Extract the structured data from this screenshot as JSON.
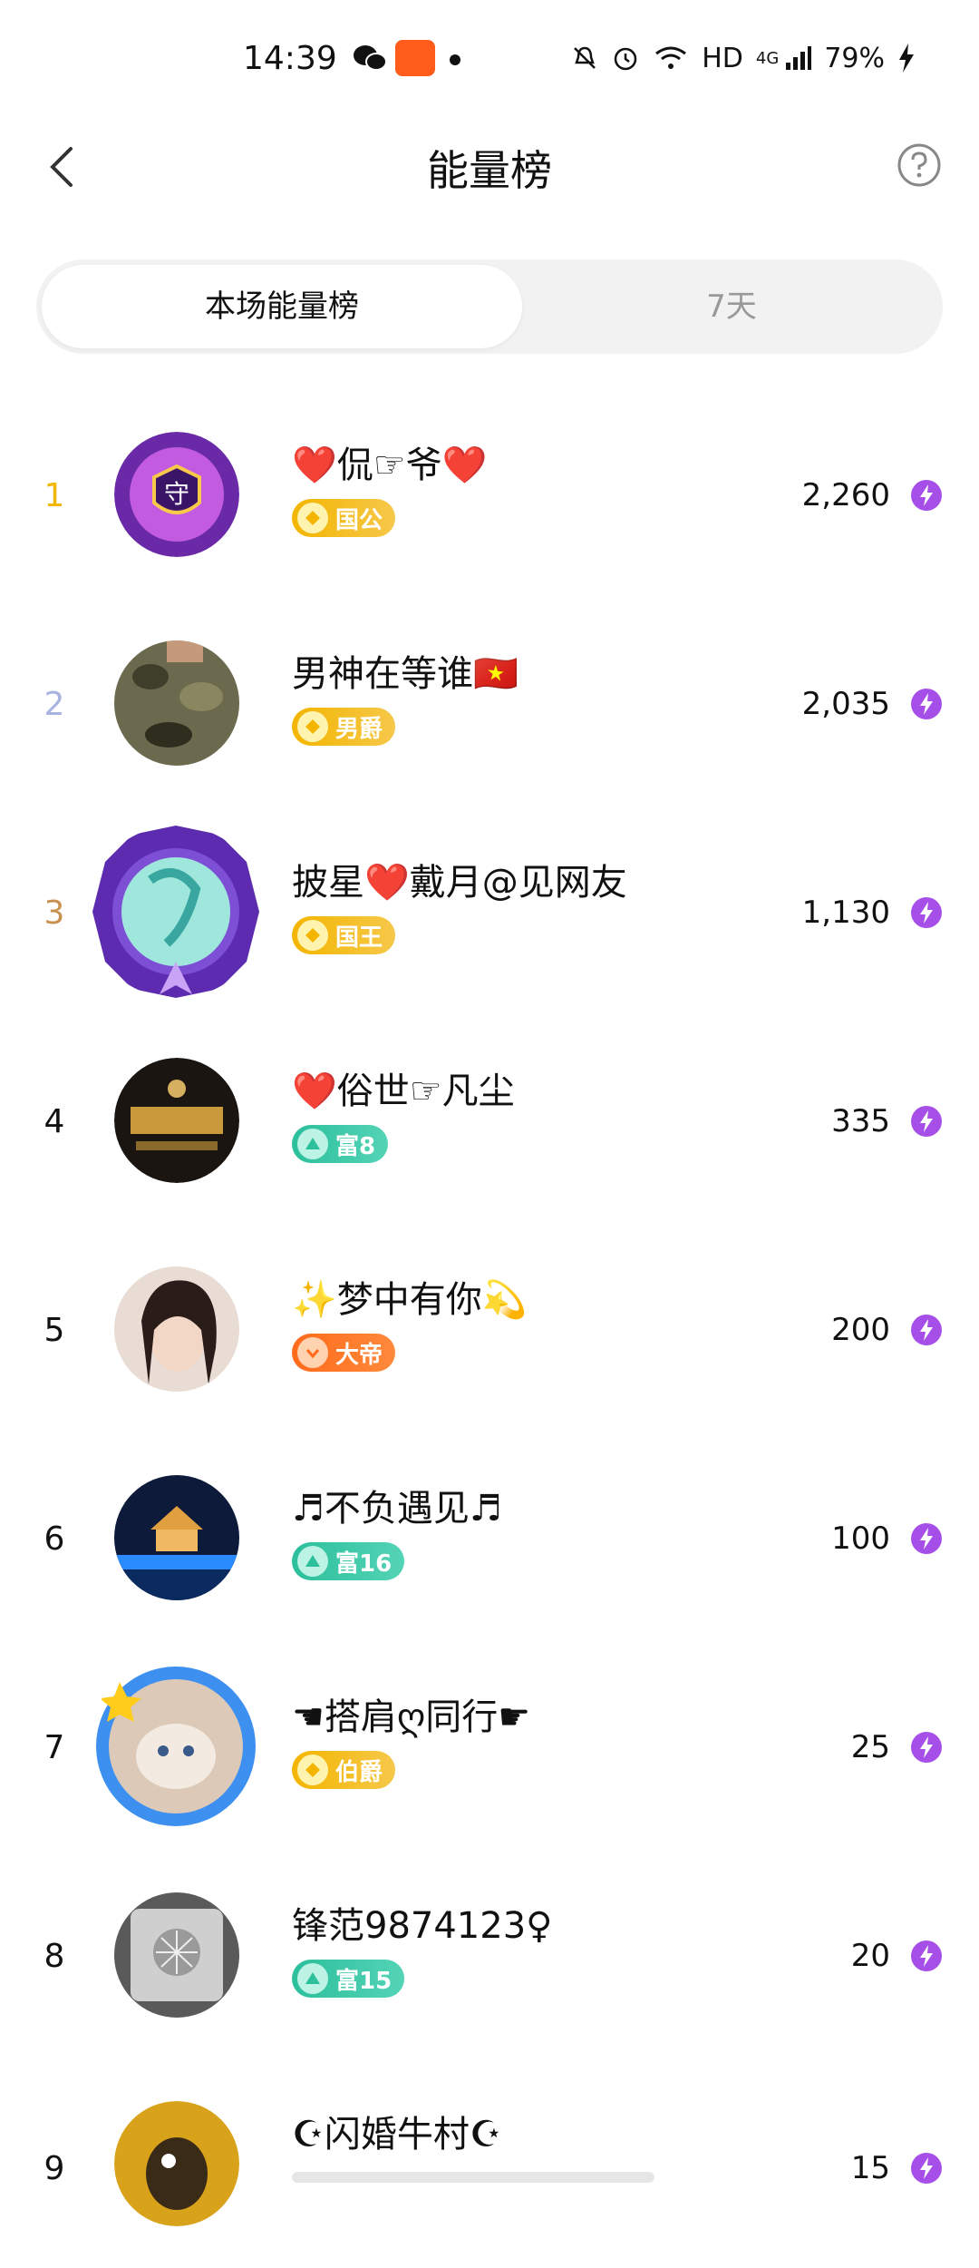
{
  "status_bar": {
    "time": "14:39",
    "network": "HD",
    "cell": "4G",
    "battery": "79%"
  },
  "header": {
    "title": "能量榜",
    "back_icon": "chevron-left-icon",
    "help_icon": "question-circle-icon"
  },
  "tabs": [
    {
      "label": "本场能量榜",
      "active": true
    },
    {
      "label": "7天",
      "active": false
    }
  ],
  "ranking": [
    {
      "rank": "1",
      "name": "❤️侃☞爷❤️",
      "badge": "国公",
      "badge_style": "gold",
      "score": "2,260",
      "rank_color": "#f2b705"
    },
    {
      "rank": "2",
      "name": "男神在等谁🇻🇳",
      "badge": "男爵",
      "badge_style": "gold",
      "score": "2,035",
      "rank_color": "#a9b3e0"
    },
    {
      "rank": "3",
      "name": "披星❤️戴月@见网友",
      "badge": "国王",
      "badge_style": "gold",
      "score": "1,130",
      "rank_color": "#c8914f"
    },
    {
      "rank": "4",
      "name": "❤️俗世☞凡尘",
      "badge": "富8",
      "badge_style": "teal",
      "score": "335",
      "rank_color": "#111111"
    },
    {
      "rank": "5",
      "name": "✨梦中有你💫",
      "badge": "大帝",
      "badge_style": "orange",
      "score": "200",
      "rank_color": "#111111"
    },
    {
      "rank": "6",
      "name": "♬不负遇见♬",
      "badge": "富16",
      "badge_style": "teal",
      "score": "100",
      "rank_color": "#111111"
    },
    {
      "rank": "7",
      "name": "☚搭肩ღ同行☛",
      "badge": "伯爵",
      "badge_style": "gold",
      "score": "25",
      "rank_color": "#111111"
    },
    {
      "rank": "8",
      "name": "锋范9874123♀",
      "badge": "富15",
      "badge_style": "teal",
      "score": "20",
      "rank_color": "#111111"
    },
    {
      "rank": "9",
      "name": "☪闪婚牛村☪",
      "badge": "",
      "badge_style": "none",
      "score": "15",
      "rank_color": "#111111"
    }
  ],
  "colors": {
    "tab_bg": "#f2f2f2",
    "energy_icon": "#a64fe8"
  }
}
